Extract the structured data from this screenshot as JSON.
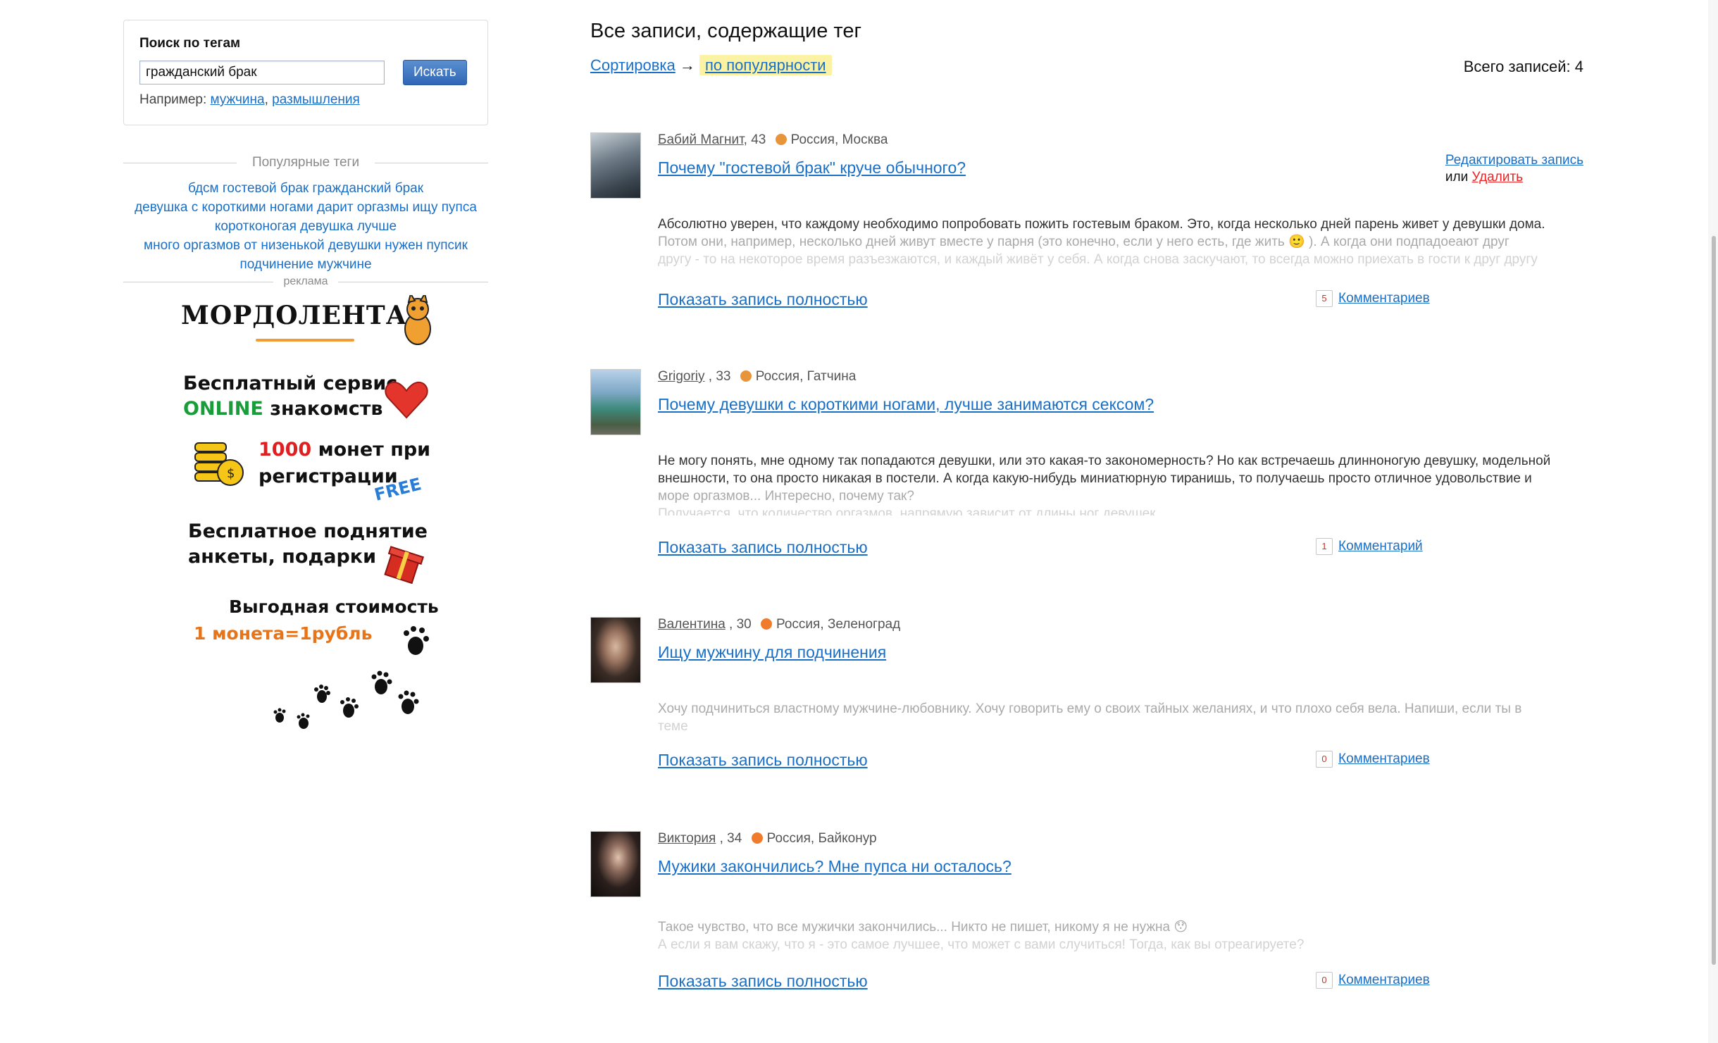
{
  "search": {
    "title": "Поиск по тегам",
    "value": "гражданский брак",
    "button": "Искать",
    "example_prefix": "Например:",
    "example_1": "мужчина",
    "example_sep": ",",
    "example_2": "размышления"
  },
  "popular": {
    "title": "Популярные теги",
    "lines": [
      "бдсм гостевой брак гражданский брак",
      "девушка с короткими ногами дарит оргазмы ищу пупса",
      "коротконогая девушка лучше",
      "много оргазмов от низенькой девушки нужен пупсик",
      "подчинение мужчине"
    ]
  },
  "ad": {
    "label": "реклама",
    "logo": "МОРДОЛЕНТА",
    "line1a": "Бесплатный сервис",
    "line1b_green": "ONLINE",
    "line1b_rest": "знакомств",
    "line2_red": "1000",
    "line2_rest": "монет при",
    "line2b": "регистрации",
    "free": "FREE",
    "line3a": "Бесплатное поднятие",
    "line3b": "анкеты, подарки",
    "line4": "Выгодная стоимость",
    "line5": "1 монета=1рубль"
  },
  "header": {
    "title": "Все записи, содержащие тег",
    "sort_label": "Сортировка",
    "sort_arrow": "→",
    "sort_value": "по популярности",
    "total": "Всего записей: 4"
  },
  "entries": [
    {
      "author": "Бабий Магнит",
      "age": ", 43",
      "location": "Россия, Москва",
      "title": "Почему \"гостевой брак\" круче обычного?",
      "line1": "Абсолютно уверен, что каждому необходимо попробовать пожить гостевым браком. Это, когда несколько дней парень живет у девушки дома.",
      "line2": "Потом они, например, несколько дней живут вместе у парня (это конечно, если у него есть, где жить 🙂 ). А когда они подпадоеают друг",
      "line3": "другу - то на некоторое время разъезжаются, и каждый живёт у себя. А когда снова заскучают, то всегда можно приехать в гости к друг другу",
      "show_full": "Показать запись полностью",
      "comments_count": "5",
      "comments_label": "Комментариев",
      "edit": "Редактировать запись",
      "or": "или",
      "delete": "Удалить"
    },
    {
      "author": "Grigoriy",
      "age": " , 33",
      "location": "Россия, Гатчина",
      "title": "Почему девушки с короткими ногами, лучше занимаются сексом?",
      "line1": "Не могу понять, мне одному так попадаются девушки, или это какая-то закономерность? Но как встречаешь длинноногую девушку, модельной",
      "line2": "внешности, то она просто никакая в постели. А когда какую-нибудь миниатюрную тиранишь, то получаешь просто отличное удовольствие и",
      "line3": "море оргазмов... Интересно, почему так?",
      "line4": "Получается, что количество оргазмов, напрямую зависит от длины ног девушек.",
      "show_full": "Показать запись полностью",
      "comments_count": "1",
      "comments_label": "Комментарий"
    },
    {
      "author": "Валентина",
      "age": " , 30",
      "location": "Россия, Зеленоград",
      "title": "Ищу мужчину для подчинения",
      "line1": "Хочу подчиниться властному мужчине-любовнику. Хочу говорить ему о своих тайных желаниях, и что плохо себя вела. Напиши, если ты в",
      "line2": "теме",
      "show_full": "Показать запись полностью",
      "comments_count": "0",
      "comments_label": "Комментариев"
    },
    {
      "author": "Виктория",
      "age": " , 34",
      "location": "Россия, Байконур",
      "title": "Мужики закончились? Мне пупса ни осталось?",
      "line1": "Такое чувство, что все мужички закончились... Никто не пишет, никому я не нужна 😯",
      "line2": "А если я вам скажу, что я - это самое лучшее, что может с вами случиться! Тогда, как вы отреагируете?",
      "show_full": "Показать запись полностью",
      "comments_count": "0",
      "comments_label": "Комментариев"
    }
  ]
}
